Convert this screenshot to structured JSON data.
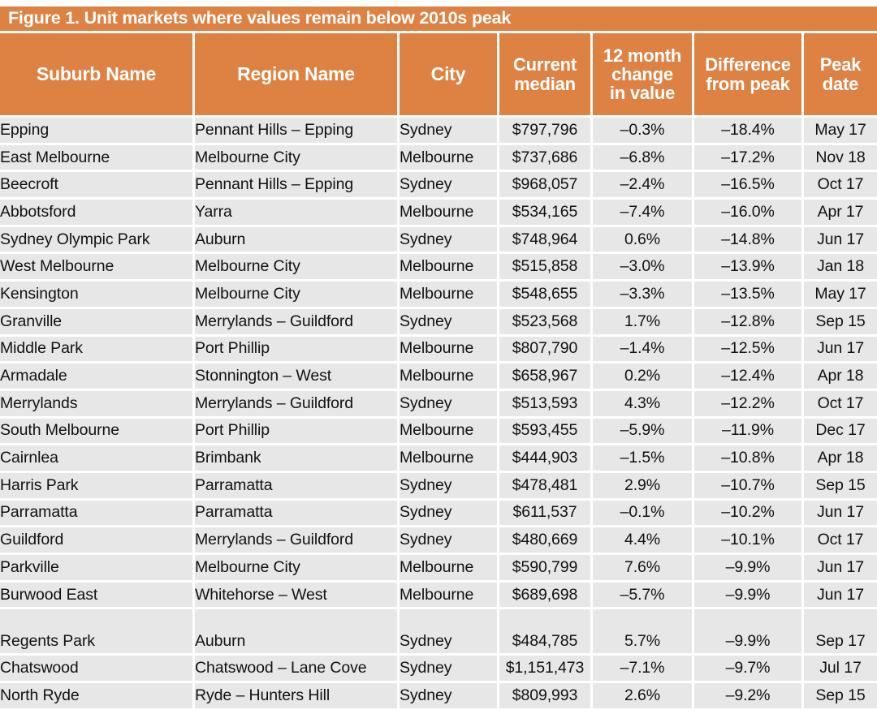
{
  "figure": {
    "title": "Figure 1. Unit markets where values remain below 2010s peak",
    "accent_color": "#DE8244",
    "row_color": "#E7E7E7",
    "gridline_color": "#FFFFFF",
    "text_color": "#111111"
  },
  "table": {
    "columns": [
      {
        "key": "suburb",
        "label": "Suburb Name"
      },
      {
        "key": "region",
        "label": "Region Name"
      },
      {
        "key": "city",
        "label": "City"
      },
      {
        "key": "median",
        "label_lines": [
          "Current",
          "median"
        ]
      },
      {
        "key": "change",
        "label_lines": [
          "12 month",
          "change",
          "in value"
        ]
      },
      {
        "key": "diff",
        "label_lines": [
          "Difference",
          "from peak"
        ]
      },
      {
        "key": "peak",
        "label_lines": [
          "Peak",
          "date"
        ]
      }
    ],
    "rows": [
      {
        "suburb": "Epping",
        "region": "Pennant Hills – Epping",
        "city": "Sydney",
        "median": "$797,796",
        "change": "–0.3%",
        "diff": "–18.4%",
        "peak": "May 17"
      },
      {
        "suburb": "East Melbourne",
        "region": "Melbourne City",
        "city": "Melbourne",
        "median": "$737,686",
        "change": "–6.8%",
        "diff": "–17.2%",
        "peak": "Nov 18"
      },
      {
        "suburb": "Beecroft",
        "region": "Pennant Hills – Epping",
        "city": "Sydney",
        "median": "$968,057",
        "change": "–2.4%",
        "diff": "–16.5%",
        "peak": "Oct 17"
      },
      {
        "suburb": "Abbotsford",
        "region": "Yarra",
        "city": "Melbourne",
        "median": "$534,165",
        "change": "–7.4%",
        "diff": "–16.0%",
        "peak": "Apr 17"
      },
      {
        "suburb": "Sydney Olympic Park",
        "region": "Auburn",
        "city": "Sydney",
        "median": "$748,964",
        "change": "0.6%",
        "diff": "–14.8%",
        "peak": "Jun 17"
      },
      {
        "suburb": "West Melbourne",
        "region": "Melbourne City",
        "city": "Melbourne",
        "median": "$515,858",
        "change": "–3.0%",
        "diff": "–13.9%",
        "peak": "Jan 18"
      },
      {
        "suburb": "Kensington",
        "region": "Melbourne City",
        "city": "Melbourne",
        "median": "$548,655",
        "change": "–3.3%",
        "diff": "–13.5%",
        "peak": "May 17"
      },
      {
        "suburb": "Granville",
        "region": "Merrylands – Guildford",
        "city": "Sydney",
        "median": "$523,568",
        "change": "1.7%",
        "diff": "–12.8%",
        "peak": "Sep 15"
      },
      {
        "suburb": "Middle Park",
        "region": "Port Phillip",
        "city": "Melbourne",
        "median": "$807,790",
        "change": "–1.4%",
        "diff": "–12.5%",
        "peak": "Jun 17"
      },
      {
        "suburb": "Armadale",
        "region": "Stonnington – West",
        "city": "Melbourne",
        "median": "$658,967",
        "change": "0.2%",
        "diff": "–12.4%",
        "peak": "Apr 18"
      },
      {
        "suburb": "Merrylands",
        "region": "Merrylands – Guildford",
        "city": "Sydney",
        "median": "$513,593",
        "change": "4.3%",
        "diff": "–12.2%",
        "peak": "Oct 17"
      },
      {
        "suburb": "South Melbourne",
        "region": "Port Phillip",
        "city": "Melbourne",
        "median": "$593,455",
        "change": "–5.9%",
        "diff": "–11.9%",
        "peak": "Dec 17"
      },
      {
        "suburb": "Cairnlea",
        "region": "Brimbank",
        "city": "Melbourne",
        "median": "$444,903",
        "change": "–1.5%",
        "diff": "–10.8%",
        "peak": "Apr 18"
      },
      {
        "suburb": "Harris Park",
        "region": "Parramatta",
        "city": "Sydney",
        "median": "$478,481",
        "change": "2.9%",
        "diff": "–10.7%",
        "peak": "Sep 15"
      },
      {
        "suburb": "Parramatta",
        "region": "Parramatta",
        "city": "Sydney",
        "median": "$611,537",
        "change": "–0.1%",
        "diff": "–10.2%",
        "peak": "Jun 17"
      },
      {
        "suburb": "Guildford",
        "region": "Merrylands – Guildford",
        "city": "Sydney",
        "median": "$480,669",
        "change": "4.4%",
        "diff": "–10.1%",
        "peak": "Oct 17"
      },
      {
        "suburb": "Parkville",
        "region": "Melbourne City",
        "city": "Melbourne",
        "median": "$590,799",
        "change": "7.6%",
        "diff": "–9.9%",
        "peak": "Jun 17"
      },
      {
        "suburb": "Burwood East",
        "region": "Whitehorse – West",
        "city": "Melbourne",
        "median": "$689,698",
        "change": "–5.7%",
        "diff": "–9.9%",
        "peak": "Jun 17"
      },
      {
        "suburb": "Regents Park",
        "region": "Auburn",
        "city": "Sydney",
        "median": "$484,785",
        "change": "5.7%",
        "diff": "–9.9%",
        "peak": "Sep 17",
        "tall": true
      },
      {
        "suburb": "Chatswood",
        "region": "Chatswood – Lane Cove",
        "city": "Sydney",
        "median": "$1,151,473",
        "change": "–7.1%",
        "diff": "–9.7%",
        "peak": "Jul 17"
      },
      {
        "suburb": "North Ryde",
        "region": "Ryde – Hunters Hill",
        "city": "Sydney",
        "median": "$809,993",
        "change": "2.6%",
        "diff": "–9.2%",
        "peak": "Sep 15"
      }
    ]
  },
  "chart_data": {
    "type": "table",
    "title": "Figure 1. Unit markets where values remain below 2010s peak",
    "columns": [
      "Suburb Name",
      "Region Name",
      "City",
      "Current median",
      "12 month change in value",
      "Difference from peak",
      "Peak date"
    ],
    "rows": [
      [
        "Epping",
        "Pennant Hills – Epping",
        "Sydney",
        "$797,796",
        "–0.3%",
        "–18.4%",
        "May 17"
      ],
      [
        "East Melbourne",
        "Melbourne City",
        "Melbourne",
        "$737,686",
        "–6.8%",
        "–17.2%",
        "Nov 18"
      ],
      [
        "Beecroft",
        "Pennant Hills – Epping",
        "Sydney",
        "$968,057",
        "–2.4%",
        "–16.5%",
        "Oct 17"
      ],
      [
        "Abbotsford",
        "Yarra",
        "Melbourne",
        "$534,165",
        "–7.4%",
        "–16.0%",
        "Apr 17"
      ],
      [
        "Sydney Olympic Park",
        "Auburn",
        "Sydney",
        "$748,964",
        "0.6%",
        "–14.8%",
        "Jun 17"
      ],
      [
        "West Melbourne",
        "Melbourne City",
        "Melbourne",
        "$515,858",
        "–3.0%",
        "–13.9%",
        "Jan 18"
      ],
      [
        "Kensington",
        "Melbourne City",
        "Melbourne",
        "$548,655",
        "–3.3%",
        "–13.5%",
        "May 17"
      ],
      [
        "Granville",
        "Merrylands – Guildford",
        "Sydney",
        "$523,568",
        "1.7%",
        "–12.8%",
        "Sep 15"
      ],
      [
        "Middle Park",
        "Port Phillip",
        "Melbourne",
        "$807,790",
        "–1.4%",
        "–12.5%",
        "Jun 17"
      ],
      [
        "Armadale",
        "Stonnington – West",
        "Melbourne",
        "$658,967",
        "0.2%",
        "–12.4%",
        "Apr 18"
      ],
      [
        "Merrylands",
        "Merrylands – Guildford",
        "Sydney",
        "$513,593",
        "4.3%",
        "–12.2%",
        "Oct 17"
      ],
      [
        "South Melbourne",
        "Port Phillip",
        "Melbourne",
        "$593,455",
        "–5.9%",
        "–11.9%",
        "Dec 17"
      ],
      [
        "Cairnlea",
        "Brimbank",
        "Melbourne",
        "$444,903",
        "–1.5%",
        "–10.8%",
        "Apr 18"
      ],
      [
        "Harris Park",
        "Parramatta",
        "Sydney",
        "$478,481",
        "2.9%",
        "–10.7%",
        "Sep 15"
      ],
      [
        "Parramatta",
        "Parramatta",
        "Sydney",
        "$611,537",
        "–0.1%",
        "–10.2%",
        "Jun 17"
      ],
      [
        "Guildford",
        "Merrylands – Guildford",
        "Sydney",
        "$480,669",
        "4.4%",
        "–10.1%",
        "Oct 17"
      ],
      [
        "Parkville",
        "Melbourne City",
        "Melbourne",
        "$590,799",
        "7.6%",
        "–9.9%",
        "Jun 17"
      ],
      [
        "Burwood East",
        "Whitehorse – West",
        "Melbourne",
        "$689,698",
        "–5.7%",
        "–9.9%",
        "Jun 17"
      ],
      [
        "Regents Park",
        "Auburn",
        "Sydney",
        "$484,785",
        "5.7%",
        "–9.9%",
        "Sep 17"
      ],
      [
        "Chatswood",
        "Chatswood – Lane Cove",
        "Sydney",
        "$1,151,473",
        "–7.1%",
        "–9.7%",
        "Jul 17"
      ],
      [
        "North Ryde",
        "Ryde – Hunters Hill",
        "Sydney",
        "$809,993",
        "2.6%",
        "–9.2%",
        "Sep 15"
      ]
    ]
  }
}
